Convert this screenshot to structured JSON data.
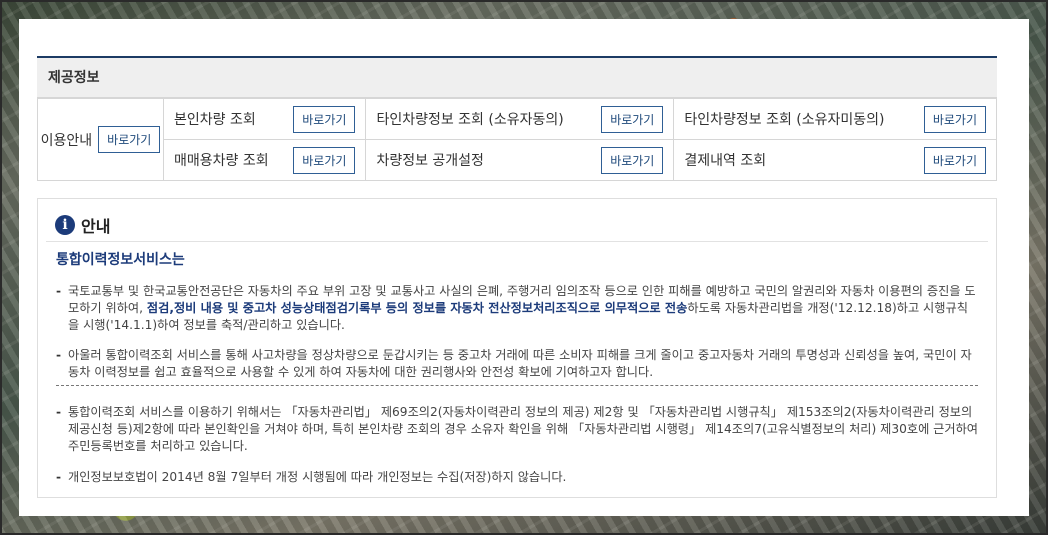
{
  "section_title": "제공정보",
  "usage": {
    "label": "이용안내",
    "button": "바로가기"
  },
  "services": [
    {
      "label": "본인차량 조회",
      "button": "바로가기"
    },
    {
      "label": "타인차량정보 조회 (소유자동의)",
      "button": "바로가기"
    },
    {
      "label": "타인차량정보 조회 (소유자미동의)",
      "button": "바로가기"
    },
    {
      "label": "매매용차량 조회",
      "button": "바로가기"
    },
    {
      "label": "차량정보 공개설정",
      "button": "바로가기"
    },
    {
      "label": "결제내역 조회",
      "button": "바로가기"
    }
  ],
  "info": {
    "icon": "info-icon",
    "title": "안내",
    "subtitle": "통합이력정보서비스는",
    "p1_a": "국토교통부 및 한국교통안전공단은 자동차의 주요 부위 고장 및 교통사고 사실의 은폐, 주행거리 임의조작 등으로 인한 피해를 예방하고 국민의 알권리와 자동차 이용편의 증진을 도모하기 위하여, ",
    "p1_b": "점검,정비 내용 및 중고차 성능상태점검기록부 등의 정보를 자동차 전산정보처리조직으로 의무적으로 전송",
    "p1_c": "하도록 자동차관리법을 개정('12.12.18)하고 시행규칙을 시행('14.1.1)하여 정보를 축적/관리하고 있습니다.",
    "p2": "아울러 통합이력조회 서비스를 통해 사고차량을 정상차량으로 둔갑시키는 등 중고차 거래에 따른 소비자 피해를 크게 줄이고 중고자동차 거래의 투명성과 신뢰성을 높여, 국민이 자동차 이력정보를 쉽고 효율적으로 사용할 수 있게 하여 자동차에 대한 권리행사와 안전성 확보에 기여하고자 합니다.",
    "p3": "통합이력조회 서비스를 이용하기 위해서는 「자동차관리법」 제69조의2(자동차이력관리 정보의 제공) 제2항 및 「자동차관리법 시행규칙」 제153조의2(자동차이력관리 정보의 제공신청 등)제2항에 따라 본인확인을 거쳐야 하며, 특히 본인차량 조회의 경우 소유자 확인을 위해 「자동차관리법 시행령」 제14조의7(고유식별정보의 처리) 제30호에 근거하여 주민등록번호를 처리하고 있습니다.",
    "p4": "개인정보보호법이 2014년 8월 7일부터 개정 시행됨에 따라 개인정보는 수집(저장)하지 않습니다."
  },
  "colors": {
    "accent": "#1c3b7a",
    "button_border": "#2f5f95",
    "header_bg": "#efefef"
  }
}
